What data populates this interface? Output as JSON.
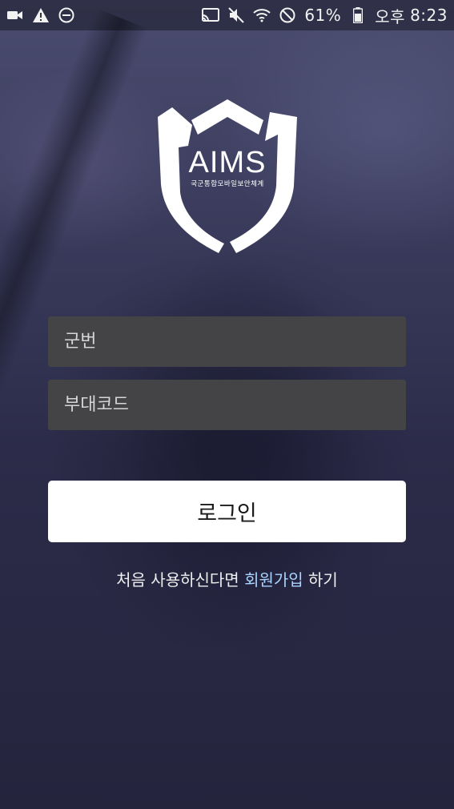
{
  "status_bar": {
    "battery_text": "61%",
    "ampm": "오후",
    "time": "8:23",
    "left_icons": [
      "video-camera-icon",
      "warning-icon",
      "do-not-disturb-icon"
    ],
    "right_icons": [
      "cast-icon",
      "mute-icon",
      "wifi-icon",
      "block-icon",
      "battery-icon"
    ]
  },
  "logo": {
    "title": "AIMS",
    "subtitle": "국군통합모바일보안체계"
  },
  "form": {
    "service_number_placeholder": "군번",
    "unit_code_placeholder": "부대코드",
    "login_label": "로그인"
  },
  "signup": {
    "prefix": "처음 사용하신다면 ",
    "link": "회원가입",
    "suffix": " 하기"
  },
  "colors": {
    "input_bg": "#444447",
    "link": "#a9d4ff",
    "button_bg": "#ffffff"
  }
}
